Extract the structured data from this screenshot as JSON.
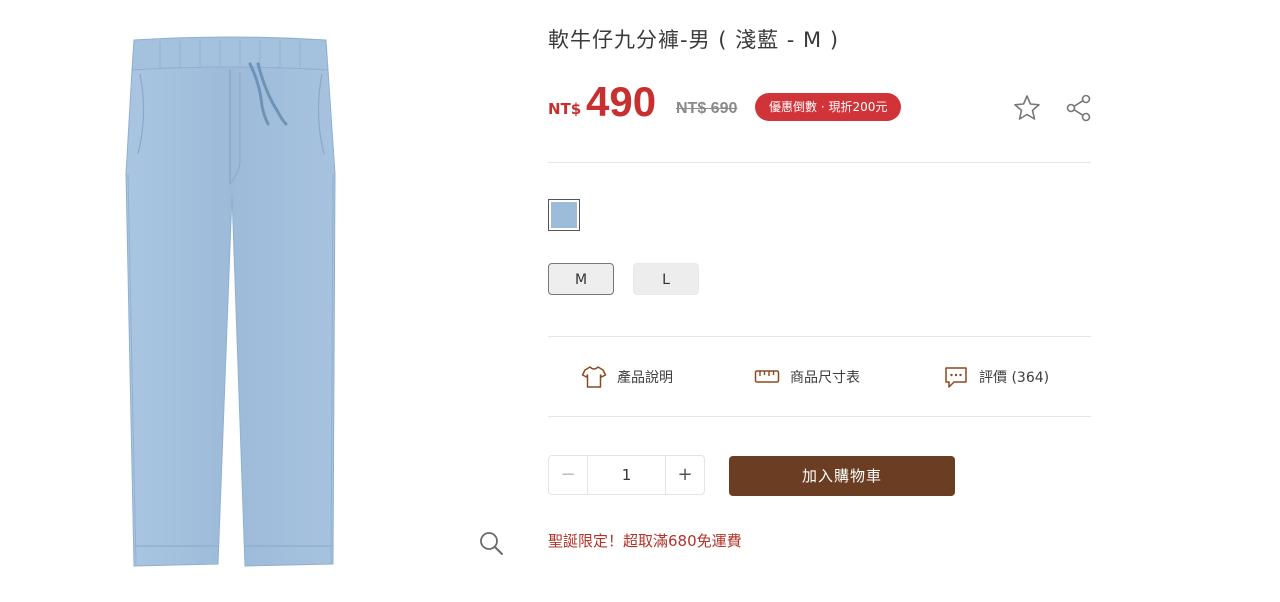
{
  "product": {
    "title": "軟牛仔九分褲-男 ( 淺藍 - M )",
    "image_alt": "light blue denim jogger pants"
  },
  "price": {
    "currency": "NT$",
    "sale": "490",
    "original": "NT$ 690",
    "promo_badge": "優惠倒數 · 現折200元",
    "accent_color": "#c8302f"
  },
  "actions": {
    "favorite_icon": "star-icon",
    "share_icon": "share-icon",
    "zoom_icon": "magnifier-icon"
  },
  "options": {
    "color_swatch": {
      "name": "淺藍",
      "color": "#9dbcd9",
      "selected": true
    },
    "sizes": [
      {
        "label": "M",
        "selected": true
      },
      {
        "label": "L",
        "selected": false
      }
    ]
  },
  "tabs": [
    {
      "label": "產品說明",
      "icon": "tshirt-icon"
    },
    {
      "label": "商品尺寸表",
      "icon": "ruler-icon"
    },
    {
      "label": "評價 (364)",
      "icon": "chat-icon"
    }
  ],
  "purchase": {
    "quantity": "1",
    "minus": "−",
    "plus": "+",
    "add_to_cart": "加入購物車",
    "button_color": "#6b3d22"
  },
  "notice": "聖誕限定！超取滿680免運費"
}
